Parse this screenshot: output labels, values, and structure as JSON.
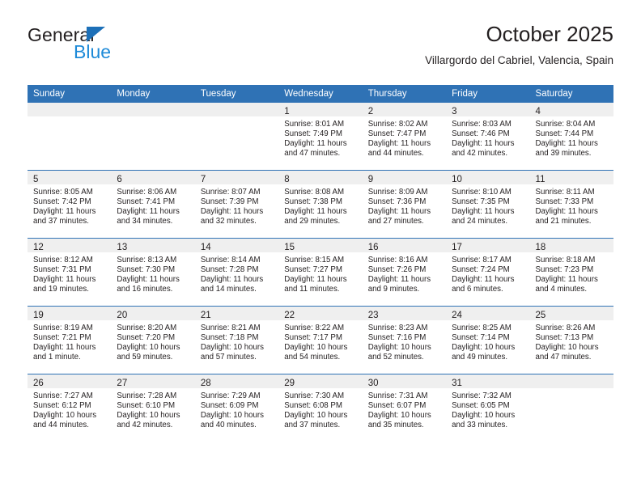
{
  "brand": {
    "name_top": "General",
    "name_bottom": "Blue",
    "triangle_color": "#1d70b8",
    "blue_color": "#1d8ad8"
  },
  "header": {
    "title": "October 2025",
    "subtitle": "Villargordo del Cabriel, Valencia, Spain"
  },
  "theme": {
    "header_blue": "#2f72b5",
    "row_rule_blue": "#2f72b5",
    "daynum_band": "#efefef"
  },
  "calendar": {
    "weekday_headers": [
      "Sunday",
      "Monday",
      "Tuesday",
      "Wednesday",
      "Thursday",
      "Friday",
      "Saturday"
    ],
    "weeks": [
      [
        {
          "day": "",
          "sunrise": "",
          "sunset": "",
          "daylight1": "",
          "daylight2": ""
        },
        {
          "day": "",
          "sunrise": "",
          "sunset": "",
          "daylight1": "",
          "daylight2": ""
        },
        {
          "day": "",
          "sunrise": "",
          "sunset": "",
          "daylight1": "",
          "daylight2": ""
        },
        {
          "day": "1",
          "sunrise": "Sunrise: 8:01 AM",
          "sunset": "Sunset: 7:49 PM",
          "daylight1": "Daylight: 11 hours",
          "daylight2": "and 47 minutes."
        },
        {
          "day": "2",
          "sunrise": "Sunrise: 8:02 AM",
          "sunset": "Sunset: 7:47 PM",
          "daylight1": "Daylight: 11 hours",
          "daylight2": "and 44 minutes."
        },
        {
          "day": "3",
          "sunrise": "Sunrise: 8:03 AM",
          "sunset": "Sunset: 7:46 PM",
          "daylight1": "Daylight: 11 hours",
          "daylight2": "and 42 minutes."
        },
        {
          "day": "4",
          "sunrise": "Sunrise: 8:04 AM",
          "sunset": "Sunset: 7:44 PM",
          "daylight1": "Daylight: 11 hours",
          "daylight2": "and 39 minutes."
        }
      ],
      [
        {
          "day": "5",
          "sunrise": "Sunrise: 8:05 AM",
          "sunset": "Sunset: 7:42 PM",
          "daylight1": "Daylight: 11 hours",
          "daylight2": "and 37 minutes."
        },
        {
          "day": "6",
          "sunrise": "Sunrise: 8:06 AM",
          "sunset": "Sunset: 7:41 PM",
          "daylight1": "Daylight: 11 hours",
          "daylight2": "and 34 minutes."
        },
        {
          "day": "7",
          "sunrise": "Sunrise: 8:07 AM",
          "sunset": "Sunset: 7:39 PM",
          "daylight1": "Daylight: 11 hours",
          "daylight2": "and 32 minutes."
        },
        {
          "day": "8",
          "sunrise": "Sunrise: 8:08 AM",
          "sunset": "Sunset: 7:38 PM",
          "daylight1": "Daylight: 11 hours",
          "daylight2": "and 29 minutes."
        },
        {
          "day": "9",
          "sunrise": "Sunrise: 8:09 AM",
          "sunset": "Sunset: 7:36 PM",
          "daylight1": "Daylight: 11 hours",
          "daylight2": "and 27 minutes."
        },
        {
          "day": "10",
          "sunrise": "Sunrise: 8:10 AM",
          "sunset": "Sunset: 7:35 PM",
          "daylight1": "Daylight: 11 hours",
          "daylight2": "and 24 minutes."
        },
        {
          "day": "11",
          "sunrise": "Sunrise: 8:11 AM",
          "sunset": "Sunset: 7:33 PM",
          "daylight1": "Daylight: 11 hours",
          "daylight2": "and 21 minutes."
        }
      ],
      [
        {
          "day": "12",
          "sunrise": "Sunrise: 8:12 AM",
          "sunset": "Sunset: 7:31 PM",
          "daylight1": "Daylight: 11 hours",
          "daylight2": "and 19 minutes."
        },
        {
          "day": "13",
          "sunrise": "Sunrise: 8:13 AM",
          "sunset": "Sunset: 7:30 PM",
          "daylight1": "Daylight: 11 hours",
          "daylight2": "and 16 minutes."
        },
        {
          "day": "14",
          "sunrise": "Sunrise: 8:14 AM",
          "sunset": "Sunset: 7:28 PM",
          "daylight1": "Daylight: 11 hours",
          "daylight2": "and 14 minutes."
        },
        {
          "day": "15",
          "sunrise": "Sunrise: 8:15 AM",
          "sunset": "Sunset: 7:27 PM",
          "daylight1": "Daylight: 11 hours",
          "daylight2": "and 11 minutes."
        },
        {
          "day": "16",
          "sunrise": "Sunrise: 8:16 AM",
          "sunset": "Sunset: 7:26 PM",
          "daylight1": "Daylight: 11 hours",
          "daylight2": "and 9 minutes."
        },
        {
          "day": "17",
          "sunrise": "Sunrise: 8:17 AM",
          "sunset": "Sunset: 7:24 PM",
          "daylight1": "Daylight: 11 hours",
          "daylight2": "and 6 minutes."
        },
        {
          "day": "18",
          "sunrise": "Sunrise: 8:18 AM",
          "sunset": "Sunset: 7:23 PM",
          "daylight1": "Daylight: 11 hours",
          "daylight2": "and 4 minutes."
        }
      ],
      [
        {
          "day": "19",
          "sunrise": "Sunrise: 8:19 AM",
          "sunset": "Sunset: 7:21 PM",
          "daylight1": "Daylight: 11 hours",
          "daylight2": "and 1 minute."
        },
        {
          "day": "20",
          "sunrise": "Sunrise: 8:20 AM",
          "sunset": "Sunset: 7:20 PM",
          "daylight1": "Daylight: 10 hours",
          "daylight2": "and 59 minutes."
        },
        {
          "day": "21",
          "sunrise": "Sunrise: 8:21 AM",
          "sunset": "Sunset: 7:18 PM",
          "daylight1": "Daylight: 10 hours",
          "daylight2": "and 57 minutes."
        },
        {
          "day": "22",
          "sunrise": "Sunrise: 8:22 AM",
          "sunset": "Sunset: 7:17 PM",
          "daylight1": "Daylight: 10 hours",
          "daylight2": "and 54 minutes."
        },
        {
          "day": "23",
          "sunrise": "Sunrise: 8:23 AM",
          "sunset": "Sunset: 7:16 PM",
          "daylight1": "Daylight: 10 hours",
          "daylight2": "and 52 minutes."
        },
        {
          "day": "24",
          "sunrise": "Sunrise: 8:25 AM",
          "sunset": "Sunset: 7:14 PM",
          "daylight1": "Daylight: 10 hours",
          "daylight2": "and 49 minutes."
        },
        {
          "day": "25",
          "sunrise": "Sunrise: 8:26 AM",
          "sunset": "Sunset: 7:13 PM",
          "daylight1": "Daylight: 10 hours",
          "daylight2": "and 47 minutes."
        }
      ],
      [
        {
          "day": "26",
          "sunrise": "Sunrise: 7:27 AM",
          "sunset": "Sunset: 6:12 PM",
          "daylight1": "Daylight: 10 hours",
          "daylight2": "and 44 minutes."
        },
        {
          "day": "27",
          "sunrise": "Sunrise: 7:28 AM",
          "sunset": "Sunset: 6:10 PM",
          "daylight1": "Daylight: 10 hours",
          "daylight2": "and 42 minutes."
        },
        {
          "day": "28",
          "sunrise": "Sunrise: 7:29 AM",
          "sunset": "Sunset: 6:09 PM",
          "daylight1": "Daylight: 10 hours",
          "daylight2": "and 40 minutes."
        },
        {
          "day": "29",
          "sunrise": "Sunrise: 7:30 AM",
          "sunset": "Sunset: 6:08 PM",
          "daylight1": "Daylight: 10 hours",
          "daylight2": "and 37 minutes."
        },
        {
          "day": "30",
          "sunrise": "Sunrise: 7:31 AM",
          "sunset": "Sunset: 6:07 PM",
          "daylight1": "Daylight: 10 hours",
          "daylight2": "and 35 minutes."
        },
        {
          "day": "31",
          "sunrise": "Sunrise: 7:32 AM",
          "sunset": "Sunset: 6:05 PM",
          "daylight1": "Daylight: 10 hours",
          "daylight2": "and 33 minutes."
        },
        {
          "day": "",
          "sunrise": "",
          "sunset": "",
          "daylight1": "",
          "daylight2": ""
        }
      ]
    ]
  }
}
